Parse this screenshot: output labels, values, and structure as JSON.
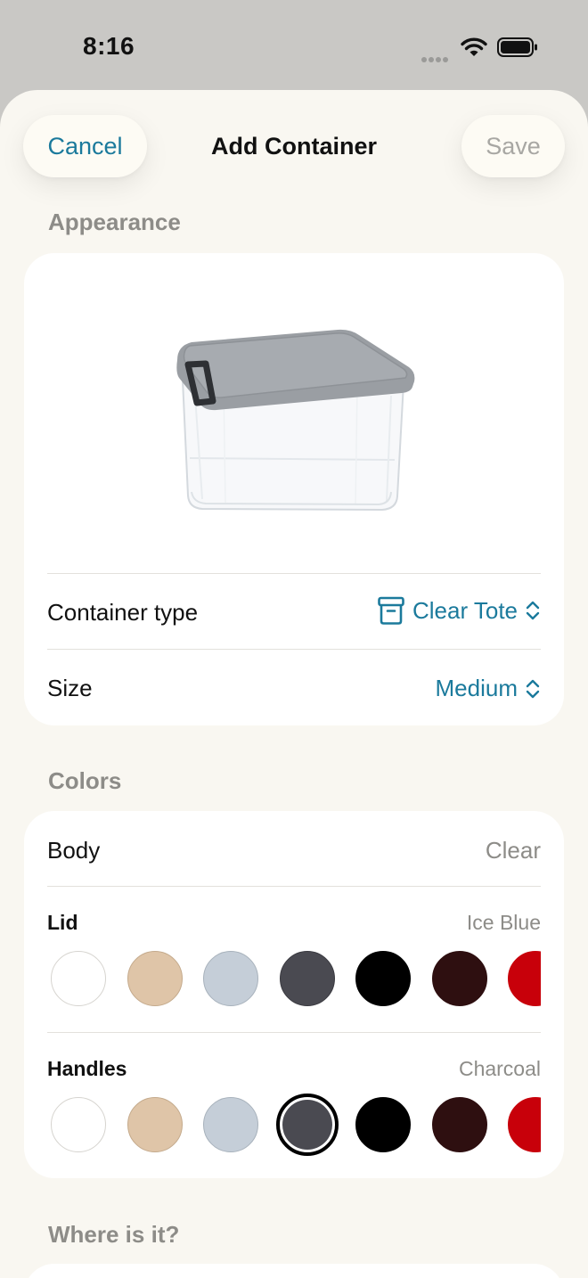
{
  "status_bar": {
    "time": "8:16"
  },
  "nav": {
    "cancel_label": "Cancel",
    "title": "Add Container",
    "save_label": "Save"
  },
  "appearance": {
    "header": "Appearance",
    "container_type": {
      "label": "Container type",
      "value": "Clear Tote"
    },
    "size": {
      "label": "Size",
      "value": "Medium"
    }
  },
  "colors": {
    "header": "Colors",
    "body": {
      "label": "Body",
      "value": "Clear"
    },
    "lid": {
      "label": "Lid",
      "value": "Ice Blue"
    },
    "handles": {
      "label": "Handles",
      "value": "Charcoal"
    },
    "palette": [
      {
        "name": "White",
        "hex": "#ffffff",
        "border": "#d6d4cf"
      },
      {
        "name": "Beige",
        "hex": "#dfc5a8",
        "border": "#c4aa8c"
      },
      {
        "name": "Ice Blue",
        "hex": "#c5ced8",
        "border": "#a8b2bc"
      },
      {
        "name": "Charcoal",
        "hex": "#4a4a51",
        "border": "#3a3a40"
      },
      {
        "name": "Black",
        "hex": "#000000",
        "border": "#000000"
      },
      {
        "name": "Dark Brown",
        "hex": "#2e0f10",
        "border": "#2e0f10"
      },
      {
        "name": "Red",
        "hex": "#c8000a",
        "border": "#c8000a"
      }
    ]
  },
  "location": {
    "header": "Where is it?"
  },
  "accent_color": "#1b7a9c"
}
